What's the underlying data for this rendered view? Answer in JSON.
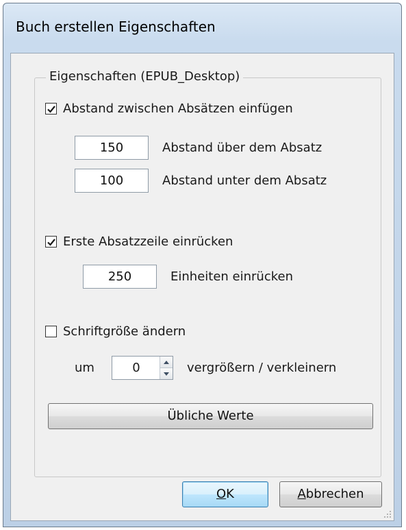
{
  "window": {
    "title": "Buch erstellen Eigenschaften"
  },
  "group": {
    "legend": "Eigenschaften (EPUB_Desktop)"
  },
  "spacing": {
    "checkbox_label": "Abstand zwischen Absätzen einfügen",
    "checked": true,
    "above_value": "150",
    "above_label": "Abstand über dem Absatz",
    "below_value": "100",
    "below_label": "Abstand unter dem Absatz"
  },
  "indent": {
    "checkbox_label": "Erste Absatzzeile einrücken",
    "checked": true,
    "value": "250",
    "label": "Einheiten einrücken"
  },
  "fontsize": {
    "checkbox_label": "Schriftgröße ändern",
    "checked": false,
    "prefix": "um",
    "value": "0",
    "suffix": "vergrößern / verkleinern"
  },
  "buttons": {
    "defaults": "Übliche Werte",
    "ok_mnemonic": "O",
    "ok_rest": "K",
    "cancel_mnemonic": "A",
    "cancel_rest": "bbrechen"
  },
  "icons": {
    "check": "checkmark-icon",
    "spin_up": "arrow-up-icon",
    "spin_down": "arrow-down-icon",
    "grip": "resize-grip-icon"
  }
}
